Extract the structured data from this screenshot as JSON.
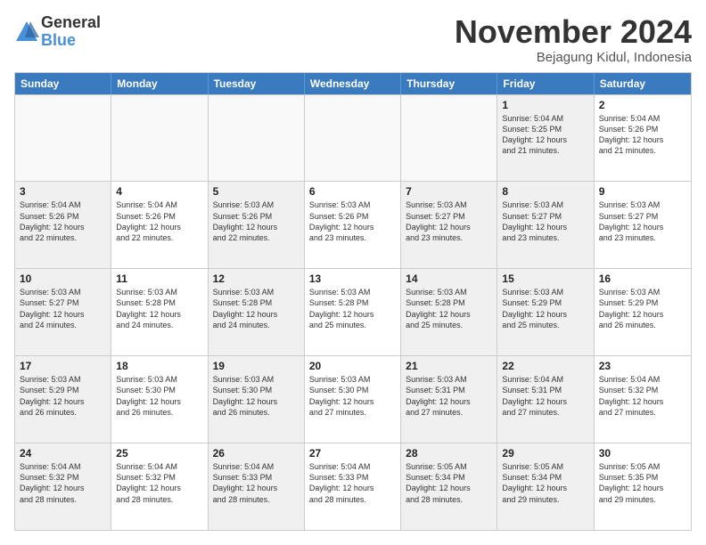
{
  "logo": {
    "general": "General",
    "blue": "Blue"
  },
  "title": "November 2024",
  "location": "Bejagung Kidul, Indonesia",
  "header_days": [
    "Sunday",
    "Monday",
    "Tuesday",
    "Wednesday",
    "Thursday",
    "Friday",
    "Saturday"
  ],
  "weeks": [
    [
      {
        "day": "",
        "info": "",
        "empty": true
      },
      {
        "day": "",
        "info": "",
        "empty": true
      },
      {
        "day": "",
        "info": "",
        "empty": true
      },
      {
        "day": "",
        "info": "",
        "empty": true
      },
      {
        "day": "",
        "info": "",
        "empty": true
      },
      {
        "day": "1",
        "info": "Sunrise: 5:04 AM\nSunset: 5:25 PM\nDaylight: 12 hours\nand 21 minutes.",
        "shaded": true
      },
      {
        "day": "2",
        "info": "Sunrise: 5:04 AM\nSunset: 5:26 PM\nDaylight: 12 hours\nand 21 minutes.",
        "shaded": false
      }
    ],
    [
      {
        "day": "3",
        "info": "Sunrise: 5:04 AM\nSunset: 5:26 PM\nDaylight: 12 hours\nand 22 minutes.",
        "shaded": true
      },
      {
        "day": "4",
        "info": "Sunrise: 5:04 AM\nSunset: 5:26 PM\nDaylight: 12 hours\nand 22 minutes."
      },
      {
        "day": "5",
        "info": "Sunrise: 5:03 AM\nSunset: 5:26 PM\nDaylight: 12 hours\nand 22 minutes.",
        "shaded": true
      },
      {
        "day": "6",
        "info": "Sunrise: 5:03 AM\nSunset: 5:26 PM\nDaylight: 12 hours\nand 23 minutes."
      },
      {
        "day": "7",
        "info": "Sunrise: 5:03 AM\nSunset: 5:27 PM\nDaylight: 12 hours\nand 23 minutes.",
        "shaded": true
      },
      {
        "day": "8",
        "info": "Sunrise: 5:03 AM\nSunset: 5:27 PM\nDaylight: 12 hours\nand 23 minutes.",
        "shaded": true
      },
      {
        "day": "9",
        "info": "Sunrise: 5:03 AM\nSunset: 5:27 PM\nDaylight: 12 hours\nand 23 minutes."
      }
    ],
    [
      {
        "day": "10",
        "info": "Sunrise: 5:03 AM\nSunset: 5:27 PM\nDaylight: 12 hours\nand 24 minutes.",
        "shaded": true
      },
      {
        "day": "11",
        "info": "Sunrise: 5:03 AM\nSunset: 5:28 PM\nDaylight: 12 hours\nand 24 minutes."
      },
      {
        "day": "12",
        "info": "Sunrise: 5:03 AM\nSunset: 5:28 PM\nDaylight: 12 hours\nand 24 minutes.",
        "shaded": true
      },
      {
        "day": "13",
        "info": "Sunrise: 5:03 AM\nSunset: 5:28 PM\nDaylight: 12 hours\nand 25 minutes."
      },
      {
        "day": "14",
        "info": "Sunrise: 5:03 AM\nSunset: 5:28 PM\nDaylight: 12 hours\nand 25 minutes.",
        "shaded": true
      },
      {
        "day": "15",
        "info": "Sunrise: 5:03 AM\nSunset: 5:29 PM\nDaylight: 12 hours\nand 25 minutes.",
        "shaded": true
      },
      {
        "day": "16",
        "info": "Sunrise: 5:03 AM\nSunset: 5:29 PM\nDaylight: 12 hours\nand 26 minutes."
      }
    ],
    [
      {
        "day": "17",
        "info": "Sunrise: 5:03 AM\nSunset: 5:29 PM\nDaylight: 12 hours\nand 26 minutes.",
        "shaded": true
      },
      {
        "day": "18",
        "info": "Sunrise: 5:03 AM\nSunset: 5:30 PM\nDaylight: 12 hours\nand 26 minutes."
      },
      {
        "day": "19",
        "info": "Sunrise: 5:03 AM\nSunset: 5:30 PM\nDaylight: 12 hours\nand 26 minutes.",
        "shaded": true
      },
      {
        "day": "20",
        "info": "Sunrise: 5:03 AM\nSunset: 5:30 PM\nDaylight: 12 hours\nand 27 minutes."
      },
      {
        "day": "21",
        "info": "Sunrise: 5:03 AM\nSunset: 5:31 PM\nDaylight: 12 hours\nand 27 minutes.",
        "shaded": true
      },
      {
        "day": "22",
        "info": "Sunrise: 5:04 AM\nSunset: 5:31 PM\nDaylight: 12 hours\nand 27 minutes.",
        "shaded": true
      },
      {
        "day": "23",
        "info": "Sunrise: 5:04 AM\nSunset: 5:32 PM\nDaylight: 12 hours\nand 27 minutes."
      }
    ],
    [
      {
        "day": "24",
        "info": "Sunrise: 5:04 AM\nSunset: 5:32 PM\nDaylight: 12 hours\nand 28 minutes.",
        "shaded": true
      },
      {
        "day": "25",
        "info": "Sunrise: 5:04 AM\nSunset: 5:32 PM\nDaylight: 12 hours\nand 28 minutes."
      },
      {
        "day": "26",
        "info": "Sunrise: 5:04 AM\nSunset: 5:33 PM\nDaylight: 12 hours\nand 28 minutes.",
        "shaded": true
      },
      {
        "day": "27",
        "info": "Sunrise: 5:04 AM\nSunset: 5:33 PM\nDaylight: 12 hours\nand 28 minutes."
      },
      {
        "day": "28",
        "info": "Sunrise: 5:05 AM\nSunset: 5:34 PM\nDaylight: 12 hours\nand 28 minutes.",
        "shaded": true
      },
      {
        "day": "29",
        "info": "Sunrise: 5:05 AM\nSunset: 5:34 PM\nDaylight: 12 hours\nand 29 minutes.",
        "shaded": true
      },
      {
        "day": "30",
        "info": "Sunrise: 5:05 AM\nSunset: 5:35 PM\nDaylight: 12 hours\nand 29 minutes."
      }
    ]
  ]
}
